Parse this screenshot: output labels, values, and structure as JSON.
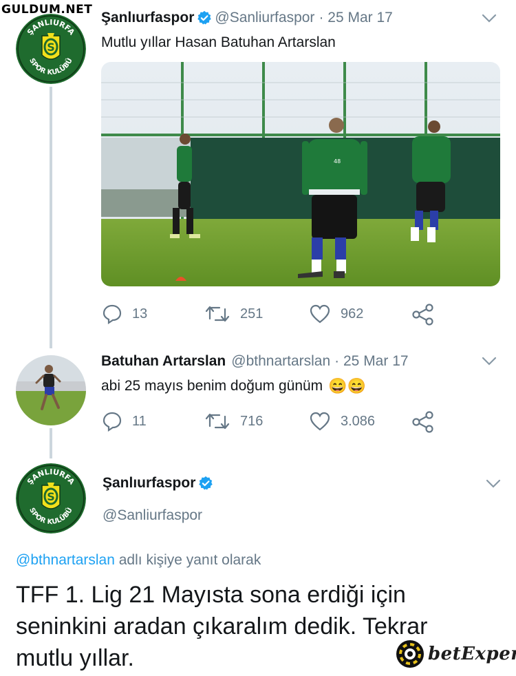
{
  "watermark": "GULDUM.NET",
  "tweet1": {
    "name": "Şanlıurfaspor",
    "handle": "@Sanliurfaspor",
    "date": "· 25 Mar 17",
    "text": "Mutlu yıllar Hasan Batuhan Artarslan",
    "replies": "13",
    "retweets": "251",
    "likes": "962",
    "image_number": "48"
  },
  "tweet2": {
    "name": "Batuhan Artarslan",
    "handle": "@bthnartarslan",
    "date": "· 25 Mar 17",
    "text": "abi 25 mayıs benim doğum günüm",
    "emoji": "😄😄",
    "replies": "11",
    "retweets": "716",
    "likes": "3.086"
  },
  "tweet3": {
    "name": "Şanlıurfaspor",
    "handle": "@Sanliurfaspor",
    "reply_mention": "@bthnartarslan",
    "reply_suffix": "adlı kişiye yanıt olarak",
    "text_line1": "TFF 1. Lig 21 Mayısta sona erdiği için",
    "text_line2": "seninkini aradan çıkaralım dedik. Tekrar",
    "text_line3": "mutlu yıllar."
  },
  "logo_text": {
    "top": "ŞANLIURFA",
    "bottom": "SPOR KULÜBÜ"
  },
  "brand": {
    "watermark_bottom": "betExper"
  },
  "colors": {
    "verified": "#1da1f2",
    "logo_green": "#1f6b2e",
    "logo_yellow": "#f2e01b",
    "mention": "#1da1f2",
    "grey": "#657786"
  }
}
